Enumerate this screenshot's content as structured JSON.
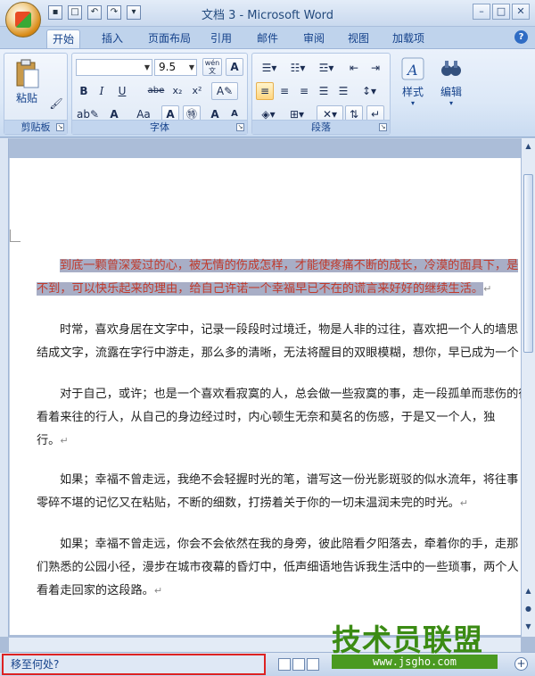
{
  "window": {
    "title": "文档 3 - Microsoft Word"
  },
  "tabs": [
    "开始",
    "插入",
    "页面布局",
    "引用",
    "邮件",
    "审阅",
    "视图",
    "加载项"
  ],
  "ribbon": {
    "clipboard": {
      "paste": "粘贴",
      "label": "剪贴板"
    },
    "font": {
      "name": "",
      "size": "9.5",
      "label": "字体",
      "wen": "wén\n文",
      "A": "A",
      "bold": "B",
      "italic": "I",
      "underline": "U",
      "strike": "abe",
      "sub": "x₂",
      "sup": "x²",
      "aa": "Aa",
      "grow": "A",
      "shrink": "A"
    },
    "paragraph": {
      "label": "段落"
    },
    "styles": {
      "label": "样式"
    },
    "editing": {
      "label": "编辑"
    }
  },
  "document": {
    "p1_l1": "到底一颗曾深爱过的心，被无情的伤成怎样，才能使疼痛不断的成长，冷漠的面具下，是",
    "p1_l2": "不到，可以快乐起来的理由，给自己许诺一个幸福早已不在的谎言来好好的继续生活。",
    "p2_l1": "时常，喜欢身居在文字中，记录一段段时过境迁，物是人非的过往，喜欢把一个人的墙思",
    "p2_l2": "结成文字，流露在字行中游走，那么多的清晰，无法将醒目的双眼模糊，想你，早已成为一个",
    "p3_l1": "对于自己，或许；也是一个喜欢看寂寞的人，总会做一些寂寞的事，走一段孤单而悲伤的径",
    "p3_l2": "看着来往的行人，从自己的身边经过时，内心顿生无奈和莫名的伤感，于是又一个人，独",
    "p3_l3": "行。",
    "p4_l1": "如果；幸福不曾走远，我绝不会轻握时光的笔，谱写这一份光影斑驳的似水流年，将往事",
    "p4_l2": "零碎不堪的记忆又在粘贴，不断的细数，打捞着关于你的一切未温润未完的时光。",
    "p5_l1": "如果；幸福不曾走远，你会不会依然在我的身旁，彼此陪看夕阳落去，牵着你的手，走那",
    "p5_l2": "们熟悉的公园小径，漫步在城市夜幕的昏灯中，低声细语地告诉我生活中的一些琐事，两个人",
    "p5_l3": "看着走回家的这段路。"
  },
  "status": {
    "goto": "移至何处?"
  },
  "watermark": {
    "text": "技术员联盟",
    "url": "www.jsgho.com"
  }
}
